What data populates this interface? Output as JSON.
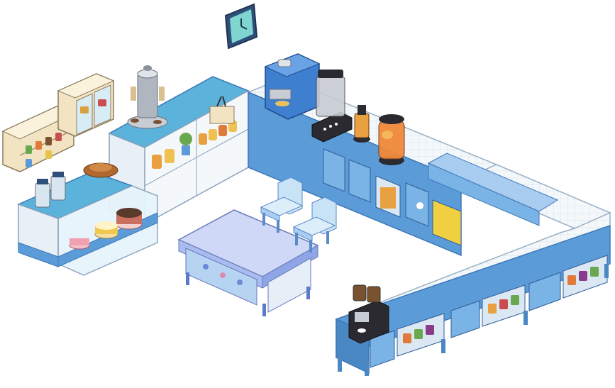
{
  "scene": {
    "theme_colors": {
      "wood_blue": "#5b9bd8",
      "wood_blue_dark": "#3d78b8",
      "wood_blue_light": "#a9cdf0",
      "counter_top": "#f4f8fb",
      "tile_line": "#d7e3ee",
      "cream": "#f7ecd2",
      "outline": "#5a6a80"
    },
    "items": [
      {
        "id": "wall-clock",
        "icon": "clock-icon"
      },
      {
        "id": "wall-shelf-left",
        "icon": "shelf-icon"
      },
      {
        "id": "wall-cabinet",
        "icon": "cabinet-icon"
      },
      {
        "id": "pastry-display-case",
        "icon": "cake-display-icon"
      },
      {
        "id": "back-shelf-unit",
        "icon": "shelf-icon"
      },
      {
        "id": "cup-dispenser",
        "icon": "cup-dispenser-icon"
      },
      {
        "id": "espresso-machine",
        "icon": "coffee-machine-icon"
      },
      {
        "id": "blender",
        "icon": "blender-icon"
      },
      {
        "id": "pepper-mill",
        "icon": "grinder-icon"
      },
      {
        "id": "juice-dispenser",
        "icon": "juice-jar-icon"
      },
      {
        "id": "l-shaped-counter",
        "icon": "counter-icon"
      },
      {
        "id": "dining-table",
        "icon": "table-icon"
      },
      {
        "id": "chair-1",
        "icon": "chair-icon"
      },
      {
        "id": "chair-2",
        "icon": "chair-icon"
      },
      {
        "id": "coffee-grinder",
        "icon": "coffee-grinder-icon"
      }
    ]
  }
}
